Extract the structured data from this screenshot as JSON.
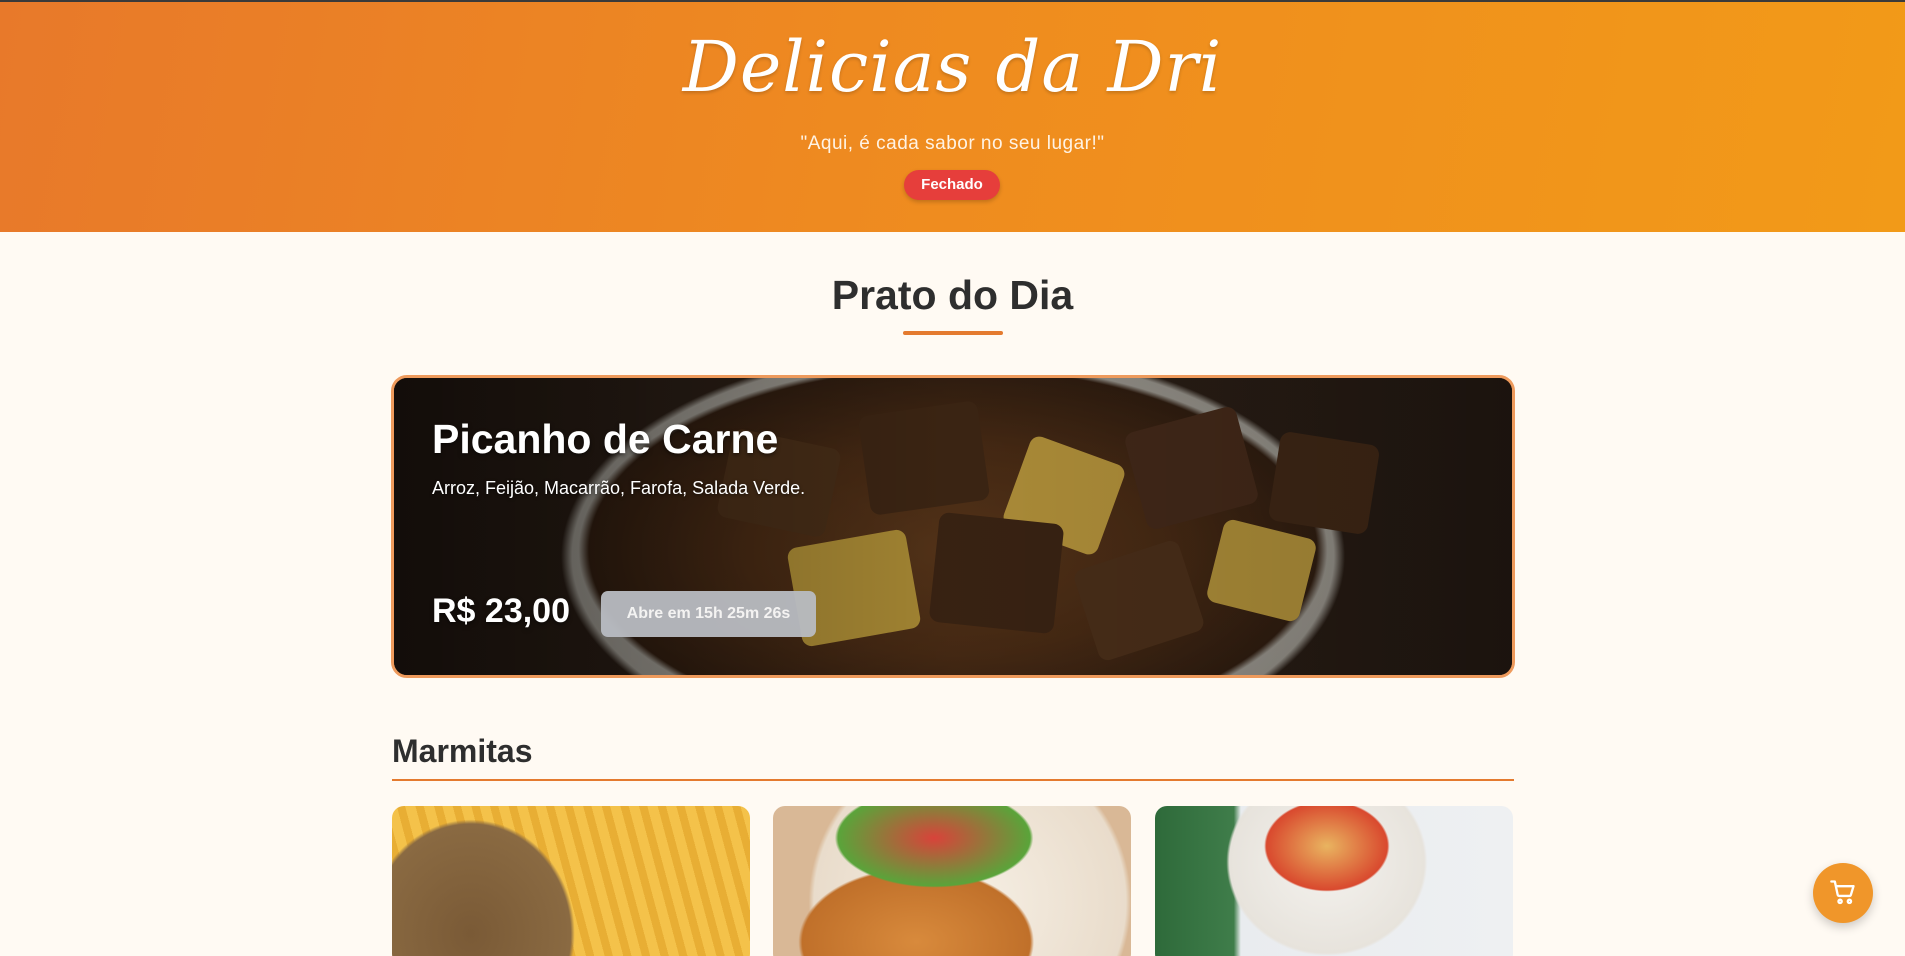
{
  "header": {
    "brand": "Delicias da Dri",
    "slogan": "\"Aqui, é cada sabor no seu lugar!\"",
    "status": "Fechado"
  },
  "daily": {
    "section_title": "Prato do Dia",
    "name": "Picanho de Carne",
    "description": "Arroz, Feijão, Macarrão, Farofa, Salada Verde.",
    "price": "R$ 23,00",
    "open_button": "Abre em 15h 25m 26s"
  },
  "menu": {
    "category_title": "Marmitas"
  },
  "cart": {
    "icon": "cart-icon"
  },
  "colors": {
    "header_start": "#e8792a",
    "header_end": "#f29a18",
    "accent": "#e47a2e",
    "status_closed": "#e63e3b",
    "cart_button": "#f0962a",
    "page_background": "#fffaf3"
  }
}
